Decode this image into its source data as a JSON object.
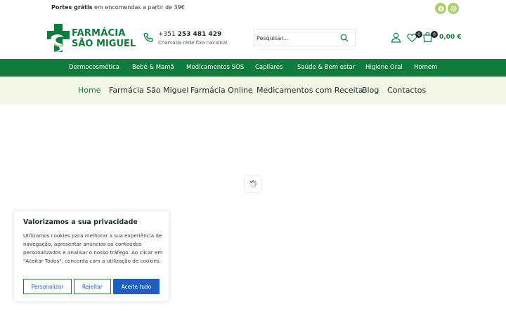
{
  "topbar": {
    "promo_bold": "Portes grátis",
    "promo_rest": " em encomendas a partir de 39€",
    "social": [
      {
        "icon": "facebook-icon"
      },
      {
        "icon": "instagram-icon"
      }
    ],
    "social_color": "#a9cf6a"
  },
  "header": {
    "logo_line1": "FARMÁCIA",
    "logo_line2": "SÃO MIGUEL",
    "phone_prefix": "+351 ",
    "phone_number": "253 481 429",
    "phone_note": "Chamada rede fixa nacional",
    "search_placeholder": "Pesquisar...",
    "wishlist_count": "0",
    "cart_count": "0",
    "cart_total": "0,00 €"
  },
  "category_nav": {
    "items": [
      "Dermocosmética",
      "Bebé & Mamã",
      "Medicamentos SOS",
      "Capilares",
      "Saúde & Bem estar",
      "Higiene Oral",
      "Homem"
    ]
  },
  "main_nav": {
    "items": [
      "Home",
      "Farmácia São Miguel",
      "Farmácia Online",
      "Medicamentos com Receita",
      "Blog",
      "Contactos"
    ],
    "active": "Home"
  },
  "cookie_banner": {
    "title": "Valorizamos a sua privacidade",
    "text": "Utilizamos cookies para melhorar a sua experiência de navegação, apresentar anúncios ou conteúdos personalizados e analisar o nosso tráfego. Ao clicar em \"Aceitar Todos\", concorda com a utilização de cookies.",
    "customize_label": "Personalizar",
    "reject_label": "Rejeitar",
    "accept_label": "Aceite tudo"
  },
  "colors": {
    "brand_green": "#0f7b3c",
    "nav_bg": "#f3f7e6",
    "button_blue": "#1d5fbf"
  }
}
